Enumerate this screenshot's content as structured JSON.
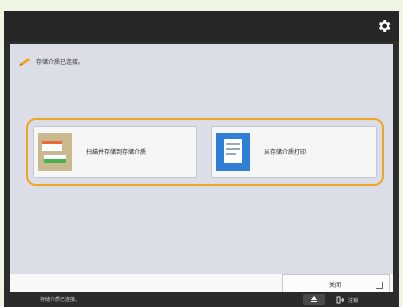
{
  "header": {
    "settings_icon": "gear-icon"
  },
  "message": {
    "icon": "pencil-icon",
    "text": "存储介质已连接。"
  },
  "options": [
    {
      "label": "扫描并存储到存储介质",
      "icon": "scan-to-media-icon"
    },
    {
      "label": "从存储介质打印",
      "icon": "print-from-media-icon"
    }
  ],
  "close_button": {
    "label": "关闭"
  },
  "status_bar": {
    "text": "存储介质已连接。",
    "logout_label": "注销"
  },
  "colors": {
    "highlight": "#f0a521",
    "panel": "#dcdee7",
    "bar": "#2b2b2b"
  }
}
